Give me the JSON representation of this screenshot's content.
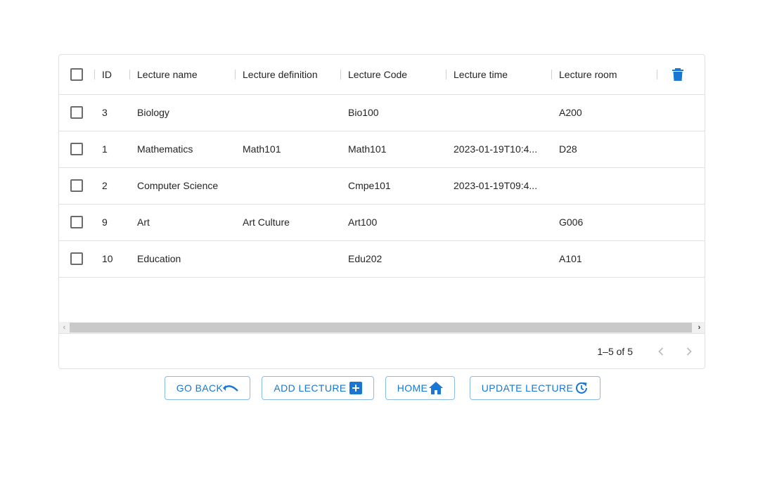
{
  "table": {
    "columns": [
      "ID",
      "Lecture name",
      "Lecture definition",
      "Lecture Code",
      "Lecture time",
      "Lecture room"
    ],
    "rows": [
      {
        "id": "3",
        "name": "Biology",
        "definition": "",
        "code": "Bio100",
        "time": "",
        "room": "A200"
      },
      {
        "id": "1",
        "name": "Mathematics",
        "definition": "Math101",
        "code": "Math101",
        "time": "2023-01-19T10:4...",
        "room": "D28"
      },
      {
        "id": "2",
        "name": "Computer Science",
        "definition": "",
        "code": "Cmpe101",
        "time": "2023-01-19T09:4...",
        "room": ""
      },
      {
        "id": "9",
        "name": "Art",
        "definition": "Art Culture",
        "code": "Art100",
        "time": "",
        "room": "G006"
      },
      {
        "id": "10",
        "name": "Education",
        "definition": "",
        "code": "Edu202",
        "time": "",
        "room": "A101"
      }
    ]
  },
  "pagination": {
    "info": "1–5 of 5"
  },
  "buttons": {
    "go_back": "GO BACK",
    "add_lecture": "ADD LECTURE",
    "home": "HOME",
    "update_lecture": "UPDATE LECTURE"
  },
  "icons": {
    "delete": "trash-icon",
    "go_back": "undo-icon",
    "add": "add-box-icon",
    "home": "home-icon",
    "update": "update-icon"
  },
  "colors": {
    "accent": "#1976d2",
    "border": "#e0e0e0",
    "scrollbar": "#c9c9c9"
  }
}
